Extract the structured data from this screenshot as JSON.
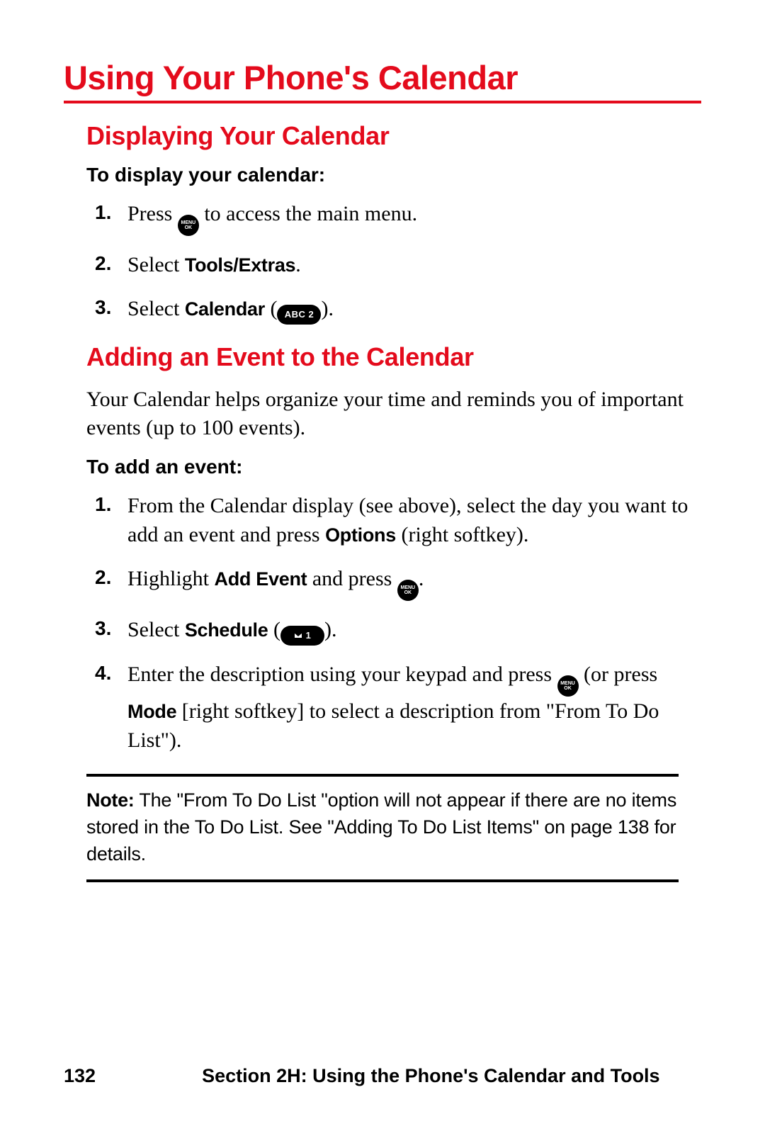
{
  "title": "Using Your Phone's Calendar",
  "sections": [
    {
      "heading": "Displaying Your Calendar",
      "lead": "To display your calendar:",
      "steps": [
        {
          "pre": "Press ",
          "icon": "menu-ok",
          "post": " to access the main menu."
        },
        {
          "pre": "Select ",
          "bold": "Tools/Extras",
          "post": "."
        },
        {
          "pre": "Select ",
          "bold": "Calendar",
          "post_open": " (",
          "pill": "ABC 2",
          "post_close": ")."
        }
      ]
    },
    {
      "heading": "Adding an Event to the Calendar",
      "intro": "Your Calendar helps organize your time and reminds you of important events (up to 100 events).",
      "lead": "To add an event:",
      "steps": [
        {
          "pre": "From the Calendar display (see above), select the day you want to add an event and press ",
          "bold": "Options",
          "post": " (right softkey)."
        },
        {
          "pre": "Highlight ",
          "bold": "Add Event",
          "mid": " and press ",
          "icon": "menu-ok",
          "post": "."
        },
        {
          "pre": "Select ",
          "bold": "Schedule",
          "post_open": " (",
          "pill": "MAIL 1",
          "post_close": ")."
        },
        {
          "pre": "Enter the description using your keypad and press ",
          "icon": "menu-ok",
          "mid": " (or press ",
          "bold": "Mode",
          "post": " [right softkey] to select a description from \"From To Do List\")."
        }
      ]
    }
  ],
  "note": {
    "label": "Note:",
    "text": " The \"From To Do List \"option will not appear if there are no items stored in the To Do List. See \"Adding To Do List Items\" on page 138 for details."
  },
  "icon_text": {
    "menu_ok": "MENU\nOK"
  },
  "footer": {
    "page": "132",
    "section": "Section 2H: Using the Phone's Calendar and Tools"
  }
}
